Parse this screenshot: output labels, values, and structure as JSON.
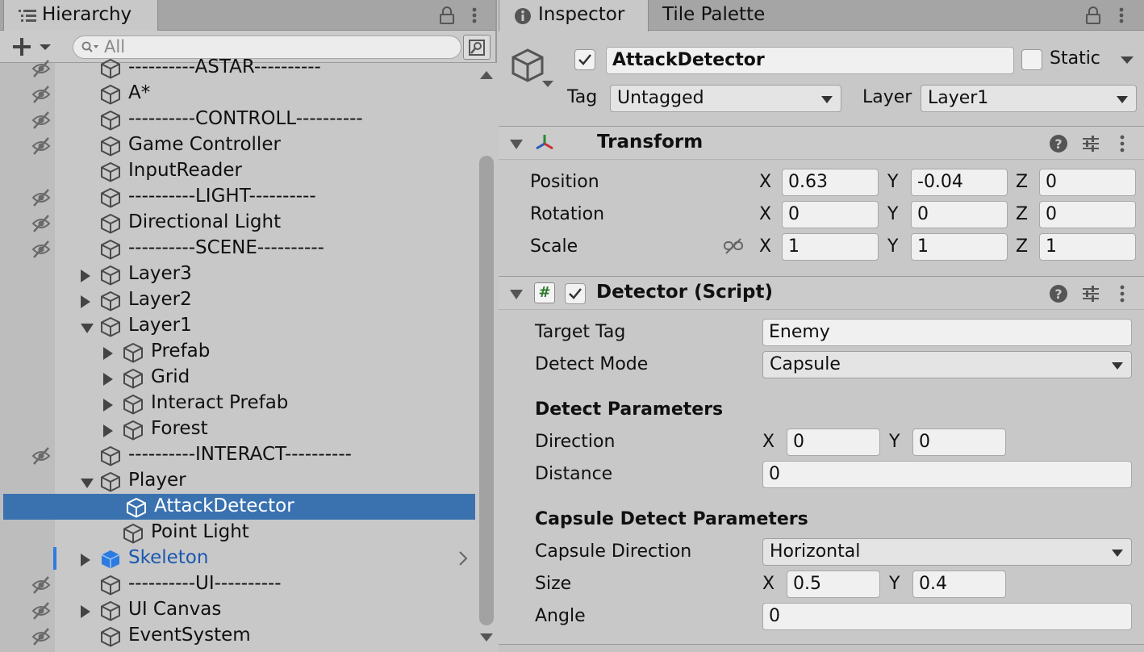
{
  "hierarchy": {
    "tab_title": "Hierarchy",
    "search_placeholder": "All",
    "items": [
      {
        "label": "----------ASTAR----------",
        "hidden": true
      },
      {
        "label": "A*",
        "hidden": true
      },
      {
        "label": "----------CONTROLL----------",
        "hidden": true
      },
      {
        "label": "Game Controller",
        "hidden": true
      },
      {
        "label": "InputReader",
        "hidden": false
      },
      {
        "label": "----------LIGHT----------",
        "hidden": true
      },
      {
        "label": "Directional Light",
        "hidden": true
      },
      {
        "label": "----------SCENE----------",
        "hidden": true
      },
      {
        "label": "Layer3",
        "hidden": false,
        "fold": "right"
      },
      {
        "label": "Layer2",
        "hidden": false,
        "fold": "right"
      },
      {
        "label": "Layer1",
        "hidden": false,
        "fold": "down"
      },
      {
        "label": "Prefab",
        "hidden": false,
        "fold": "right",
        "indent": 1
      },
      {
        "label": "Grid",
        "hidden": false,
        "fold": "right",
        "indent": 1
      },
      {
        "label": "Interact Prefab",
        "hidden": false,
        "fold": "right",
        "indent": 1
      },
      {
        "label": "Forest",
        "hidden": false,
        "fold": "right",
        "indent": 1
      },
      {
        "label": "----------INTERACT----------",
        "hidden": true
      },
      {
        "label": "Player",
        "hidden": false,
        "fold": "down"
      },
      {
        "label": "AttackDetector",
        "hidden": false,
        "indent": 1,
        "selected": true
      },
      {
        "label": "Point Light",
        "hidden": false,
        "indent": 1
      },
      {
        "label": "Skeleton",
        "hidden": false,
        "fold": "right",
        "prefab": true
      },
      {
        "label": "----------UI----------",
        "hidden": true
      },
      {
        "label": "UI Canvas",
        "hidden": true,
        "fold": "right"
      },
      {
        "label": "EventSystem",
        "hidden": true
      }
    ]
  },
  "inspector": {
    "tab_inspector": "Inspector",
    "tab_tile_palette": "Tile Palette",
    "object_name": "AttackDetector",
    "static_label": "Static",
    "tag_label": "Tag",
    "tag_value": "Untagged",
    "layer_label": "Layer",
    "layer_value": "Layer1",
    "transform": {
      "title": "Transform",
      "position_label": "Position",
      "rotation_label": "Rotation",
      "scale_label": "Scale",
      "position": {
        "x": "0.63",
        "y": "-0.04",
        "z": "0"
      },
      "rotation": {
        "x": "0",
        "y": "0",
        "z": "0"
      },
      "scale": {
        "x": "1",
        "y": "1",
        "z": "1"
      }
    },
    "detector": {
      "title": "Detector (Script)",
      "target_tag_label": "Target Tag",
      "target_tag_value": "Enemy",
      "detect_mode_label": "Detect Mode",
      "detect_mode_value": "Capsule",
      "detect_params_header": "Detect Parameters",
      "direction_label": "Direction",
      "direction": {
        "x": "0",
        "y": "0"
      },
      "distance_label": "Distance",
      "distance_value": "0",
      "capsule_header": "Capsule Detect Parameters",
      "capsule_direction_label": "Capsule Direction",
      "capsule_direction_value": "Horizontal",
      "size_label": "Size",
      "size": {
        "x": "0.5",
        "y": "0.4"
      },
      "angle_label": "Angle",
      "angle_value": "0"
    },
    "axis_labels": {
      "x": "X",
      "y": "Y",
      "z": "Z"
    }
  },
  "colors": {
    "panel_bg": "#c8c8c8",
    "selection": "#3a72b0",
    "prefab_text": "#1a58b0"
  }
}
